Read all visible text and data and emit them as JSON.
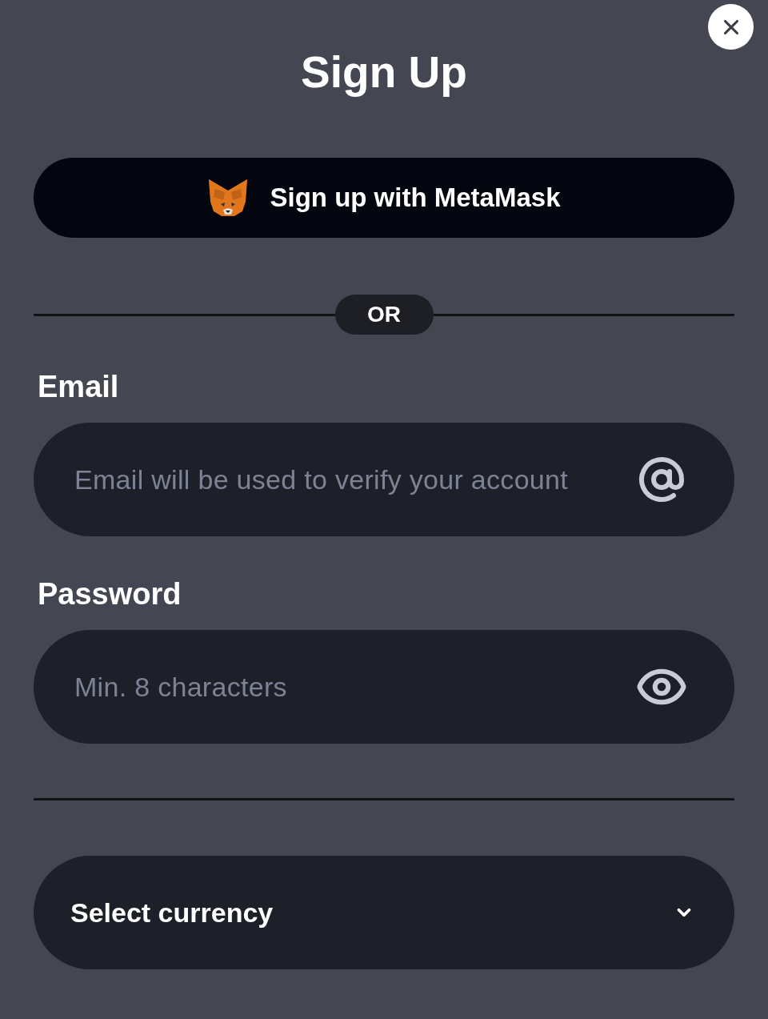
{
  "dialog": {
    "title": "Sign Up"
  },
  "metamask_button": {
    "label": "Sign up with MetaMask"
  },
  "separator": {
    "label": "OR"
  },
  "fields": [
    {
      "kind": "email",
      "label": "Email",
      "placeholder": "Email will be used to verify your account"
    },
    {
      "kind": "password",
      "label": "Password",
      "placeholder": "Min. 8 characters"
    }
  ],
  "currency_select": {
    "value": "Select currency"
  }
}
